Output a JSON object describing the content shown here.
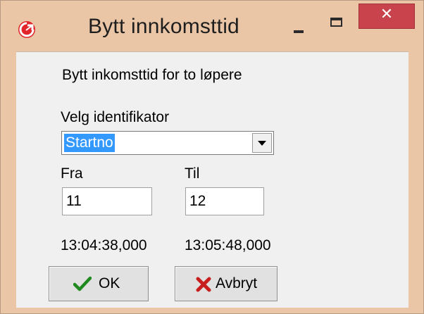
{
  "window": {
    "title": "Bytt innkomsttid",
    "app_icon": "red-circular-app-icon",
    "controls": {
      "minimize_icon": "minimize-icon",
      "maximize_icon": "maximize-icon",
      "close_glyph": "✕"
    },
    "colors": {
      "frame": "#eac6a6",
      "close_button": "#c8434b",
      "selection": "#3399ff"
    }
  },
  "dialog": {
    "description": "Bytt inkomsttid for to løpere",
    "identifier": {
      "label": "Velg identifikator",
      "selected": "Startno",
      "dropdown_icon": "chevron-down-icon"
    },
    "from": {
      "label": "Fra",
      "value": "11",
      "time": "13:04:38,000"
    },
    "to": {
      "label": "Til",
      "value": "12",
      "time": "13:05:48,000"
    },
    "buttons": {
      "ok": {
        "label": "OK",
        "icon": "green-checkmark-icon"
      },
      "cancel": {
        "label": "Avbryt",
        "icon": "red-x-icon"
      }
    }
  }
}
